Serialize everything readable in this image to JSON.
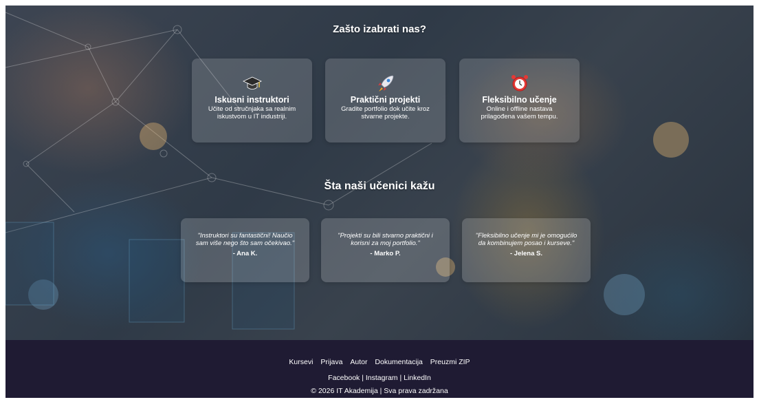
{
  "why_section": {
    "title": "Zašto izabrati nas?",
    "features": [
      {
        "icon": "graduation-cap-icon",
        "title": "Iskusni instruktori",
        "text": "Učite od stručnjaka sa realnim iskustvom u IT industriji."
      },
      {
        "icon": "rocket-icon",
        "title": "Praktični projekti",
        "text": "Gradite portfolio dok učite kroz stvarne projekte."
      },
      {
        "icon": "alarm-clock-icon",
        "title": "Fleksibilno učenje",
        "text": "Online i offline nastava prilagođena vašem tempu."
      }
    ]
  },
  "testimonials_section": {
    "title": "Šta naši učenici kažu",
    "items": [
      {
        "quote": "\"Instruktori su fantastični! Naučio sam više nego što sam očekivao.\"",
        "author": "- Ana K."
      },
      {
        "quote": "\"Projekti su bili stvarno praktični i korisni za moj portfolio.\"",
        "author": "- Marko P."
      },
      {
        "quote": "\"Fleksibilno učenje mi je omogućilo da kombinujem posao i kurseve.\"",
        "author": "- Jelena S."
      }
    ]
  },
  "footer": {
    "nav": [
      "Kursevi",
      "Prijava",
      "Autor",
      "Dokumentacija",
      "Preuzmi ZIP"
    ],
    "social": [
      "Facebook",
      "Instagram",
      "LinkedIn"
    ],
    "social_separator": " | ",
    "copyright": "© 2026 IT Akademija | Sva prava zadržana"
  },
  "colors": {
    "footer_bg": "#1f1b33",
    "text": "#ffffff",
    "card_bg": "rgba(255,255,255,0.16)"
  }
}
